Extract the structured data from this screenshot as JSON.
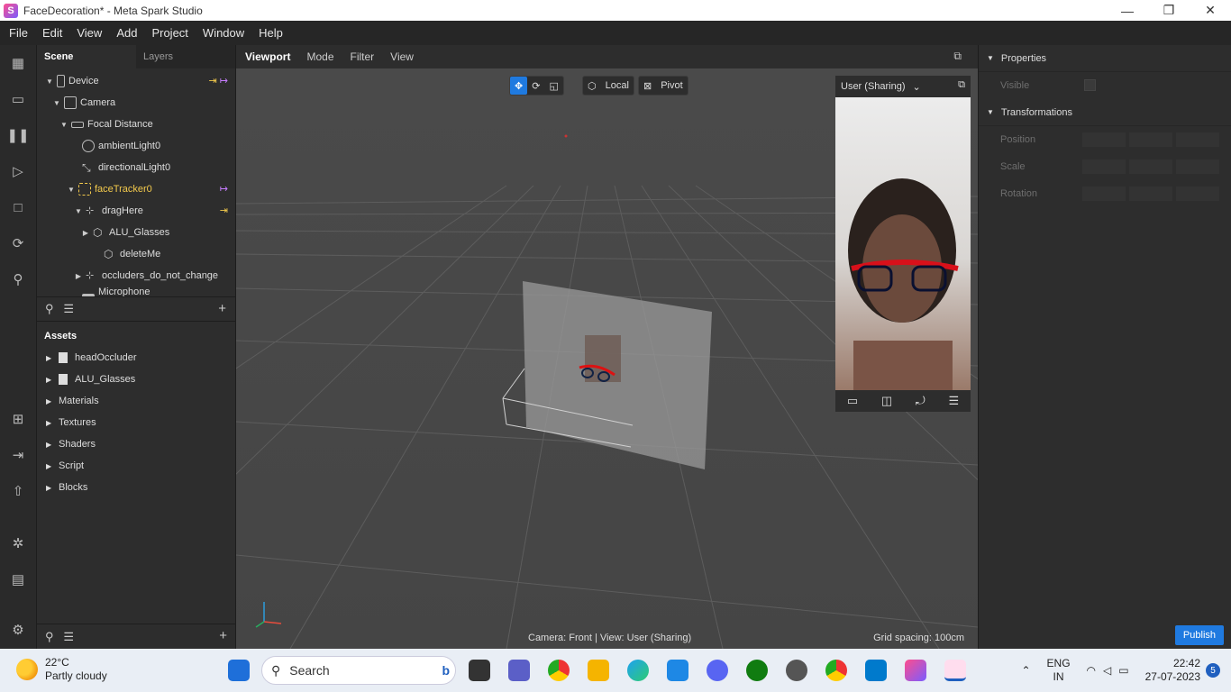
{
  "window": {
    "title": "FaceDecoration* - Meta Spark Studio",
    "logo": "S",
    "min": "—",
    "max": "❐",
    "close": "✕"
  },
  "menu": [
    "File",
    "Edit",
    "View",
    "Add",
    "Project",
    "Window",
    "Help"
  ],
  "scene": {
    "tabs": [
      "Scene",
      "Layers"
    ],
    "rows": [
      {
        "label": "Device",
        "arrow": "▼",
        "depth": 0
      },
      {
        "label": "Camera",
        "arrow": "▼",
        "depth": 1
      },
      {
        "label": "Focal Distance",
        "arrow": "▼",
        "depth": 2
      },
      {
        "label": "ambientLight0",
        "arrow": "",
        "depth": 3
      },
      {
        "label": "directionalLight0",
        "arrow": "",
        "depth": 3
      },
      {
        "label": "faceTracker0",
        "arrow": "▼",
        "depth": 3
      },
      {
        "label": "dragHere",
        "arrow": "▼",
        "depth": 4
      },
      {
        "label": "ALU_Glasses",
        "arrow": "▶",
        "depth": 5
      },
      {
        "label": "deleteMe",
        "arrow": "",
        "depth": 5
      },
      {
        "label": "occluders_do_not_change",
        "arrow": "▶",
        "depth": 4
      },
      {
        "label": "Microphone",
        "arrow": "",
        "depth": 3
      }
    ]
  },
  "assets": {
    "title": "Assets",
    "items": [
      "headOccluder",
      "ALU_Glasses",
      "Materials",
      "Textures",
      "Shaders",
      "Script",
      "Blocks"
    ]
  },
  "viewport": {
    "tabs": [
      "Viewport",
      "Mode",
      "Filter",
      "View"
    ],
    "local": "Local",
    "pivot": "Pivot",
    "status": "Camera: Front | View: User (Sharing)",
    "grid": "Grid spacing: 100cm"
  },
  "preview": {
    "label": "User (Sharing)"
  },
  "properties": {
    "title": "Properties",
    "visible": "Visible",
    "transformations": "Transformations",
    "position": "Position",
    "scale": "Scale",
    "rotation": "Rotation",
    "publish": "Publish"
  },
  "taskbar": {
    "temp": "22°C",
    "weather": "Partly cloudy",
    "search": "Search",
    "lang1": "ENG",
    "lang2": "IN",
    "time": "22:42",
    "date": "27-07-2023",
    "notif": "5"
  },
  "colors": {
    "accent": "#1f7ae0",
    "highlight": "#f2c94c",
    "purple": "#c77dff"
  }
}
